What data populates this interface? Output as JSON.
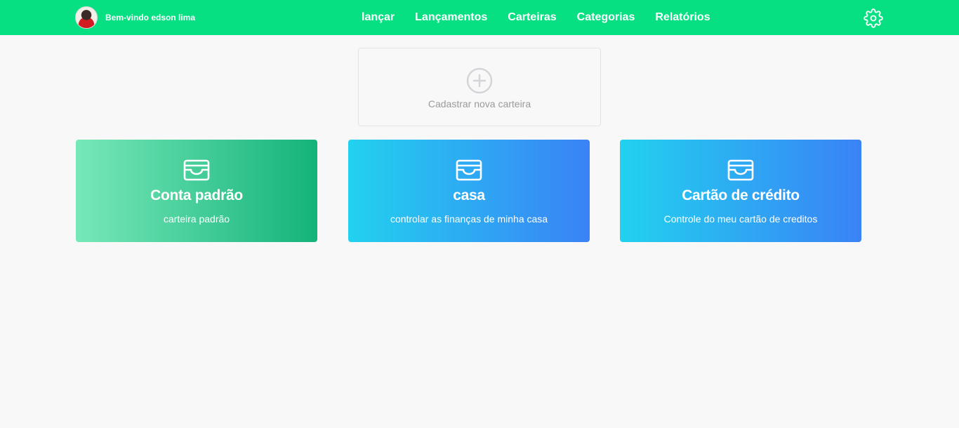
{
  "header": {
    "welcome": "Bem-vindo edson lima",
    "nav": [
      "lançar",
      "Lançamentos",
      "Carteiras",
      "Categorias",
      "Relatórios"
    ],
    "settings_icon": "gear-icon",
    "background": "#06e083"
  },
  "new_wallet": {
    "label": "Cadastrar nova carteira",
    "icon": "plus-circle-icon"
  },
  "wallets": [
    {
      "name": "Conta padrão",
      "description": "carteira padrão",
      "icon": "wallet-icon",
      "colors": [
        "#77e8b8",
        "#14b37a"
      ]
    },
    {
      "name": "casa",
      "description": "controlar as finanças de minha casa",
      "icon": "wallet-icon",
      "colors": [
        "#22d1ef",
        "#3a82f6"
      ]
    },
    {
      "name": "Cartão de crédito",
      "description": "Controle do meu cartão de creditos",
      "icon": "wallet-icon",
      "colors": [
        "#22d1ef",
        "#3a82f6"
      ]
    }
  ]
}
